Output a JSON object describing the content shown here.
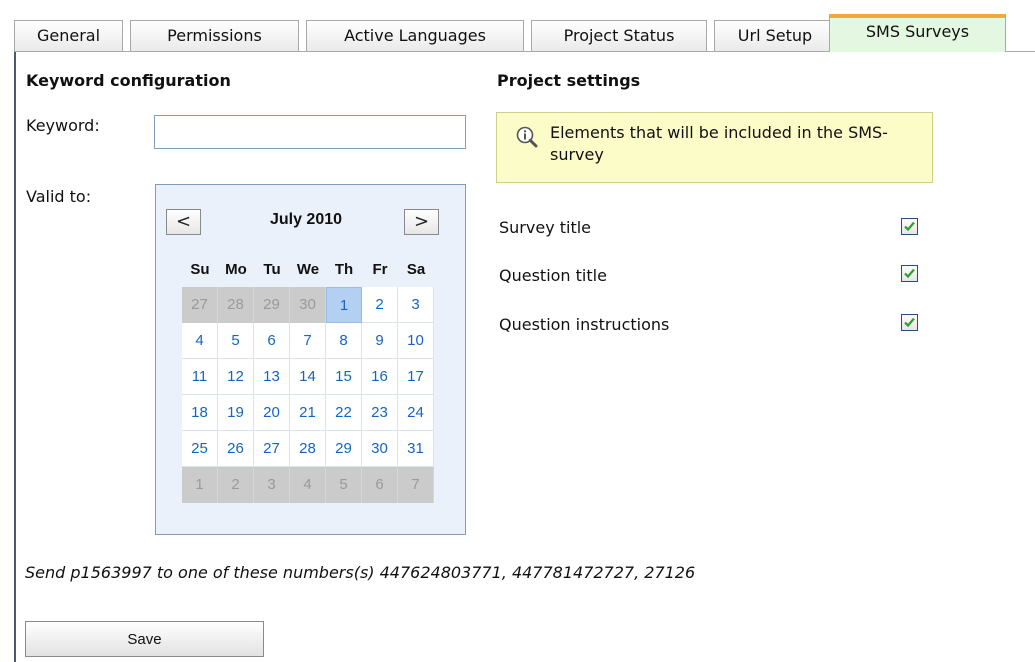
{
  "tabs": [
    {
      "label": "General"
    },
    {
      "label": "Permissions"
    },
    {
      "label": "Active Languages"
    },
    {
      "label": "Project Status"
    },
    {
      "label": "Url Setup"
    },
    {
      "label": "SMS Surveys",
      "active": true
    }
  ],
  "keyword_section": {
    "heading": "Keyword configuration",
    "keyword_label": "Keyword:",
    "keyword_value": "",
    "valid_to_label": "Valid to:"
  },
  "calendar": {
    "month_label": "July 2010",
    "prev_icon": "chevron-left-icon",
    "next_icon": "chevron-right-icon",
    "prev_glyph": "<",
    "next_glyph": ">",
    "weekdays": [
      "Su",
      "Mo",
      "Tu",
      "We",
      "Th",
      "Fr",
      "Sa"
    ],
    "weeks": [
      [
        {
          "d": "27",
          "o": true
        },
        {
          "d": "28",
          "o": true
        },
        {
          "d": "29",
          "o": true
        },
        {
          "d": "30",
          "o": true
        },
        {
          "d": "1",
          "s": true
        },
        {
          "d": "2"
        },
        {
          "d": "3"
        }
      ],
      [
        {
          "d": "4"
        },
        {
          "d": "5"
        },
        {
          "d": "6"
        },
        {
          "d": "7"
        },
        {
          "d": "8"
        },
        {
          "d": "9"
        },
        {
          "d": "10"
        }
      ],
      [
        {
          "d": "11"
        },
        {
          "d": "12"
        },
        {
          "d": "13"
        },
        {
          "d": "14"
        },
        {
          "d": "15"
        },
        {
          "d": "16"
        },
        {
          "d": "17"
        }
      ],
      [
        {
          "d": "18"
        },
        {
          "d": "19"
        },
        {
          "d": "20"
        },
        {
          "d": "21"
        },
        {
          "d": "22"
        },
        {
          "d": "23"
        },
        {
          "d": "24"
        }
      ],
      [
        {
          "d": "25"
        },
        {
          "d": "26"
        },
        {
          "d": "27"
        },
        {
          "d": "28"
        },
        {
          "d": "29"
        },
        {
          "d": "30"
        },
        {
          "d": "31"
        }
      ],
      [
        {
          "d": "1",
          "o": true
        },
        {
          "d": "2",
          "o": true
        },
        {
          "d": "3",
          "o": true
        },
        {
          "d": "4",
          "o": true
        },
        {
          "d": "5",
          "o": true
        },
        {
          "d": "6",
          "o": true
        },
        {
          "d": "7",
          "o": true
        }
      ]
    ]
  },
  "project_settings": {
    "heading": "Project settings",
    "info_icon": "magnifier-info-icon",
    "info_text": "Elements that will be included in the SMS-survey",
    "options": [
      {
        "label": "Survey title",
        "checked": true
      },
      {
        "label": "Question title",
        "checked": true
      },
      {
        "label": "Question instructions",
        "checked": true
      }
    ]
  },
  "send_text": "Send p1563997 to one of these numbers(s) 447624803771, 447781472727, 27126",
  "save_label": "Save",
  "colors": {
    "active_tab_bg": "#e3f7e1",
    "active_tab_accent": "#f2a93b",
    "calendar_bg": "#eaf1fb",
    "day_link": "#1565c0",
    "selected_day_bg": "#b3d0f2",
    "info_bg": "#fcfcc8",
    "check_mark": "#2e9e2e"
  }
}
